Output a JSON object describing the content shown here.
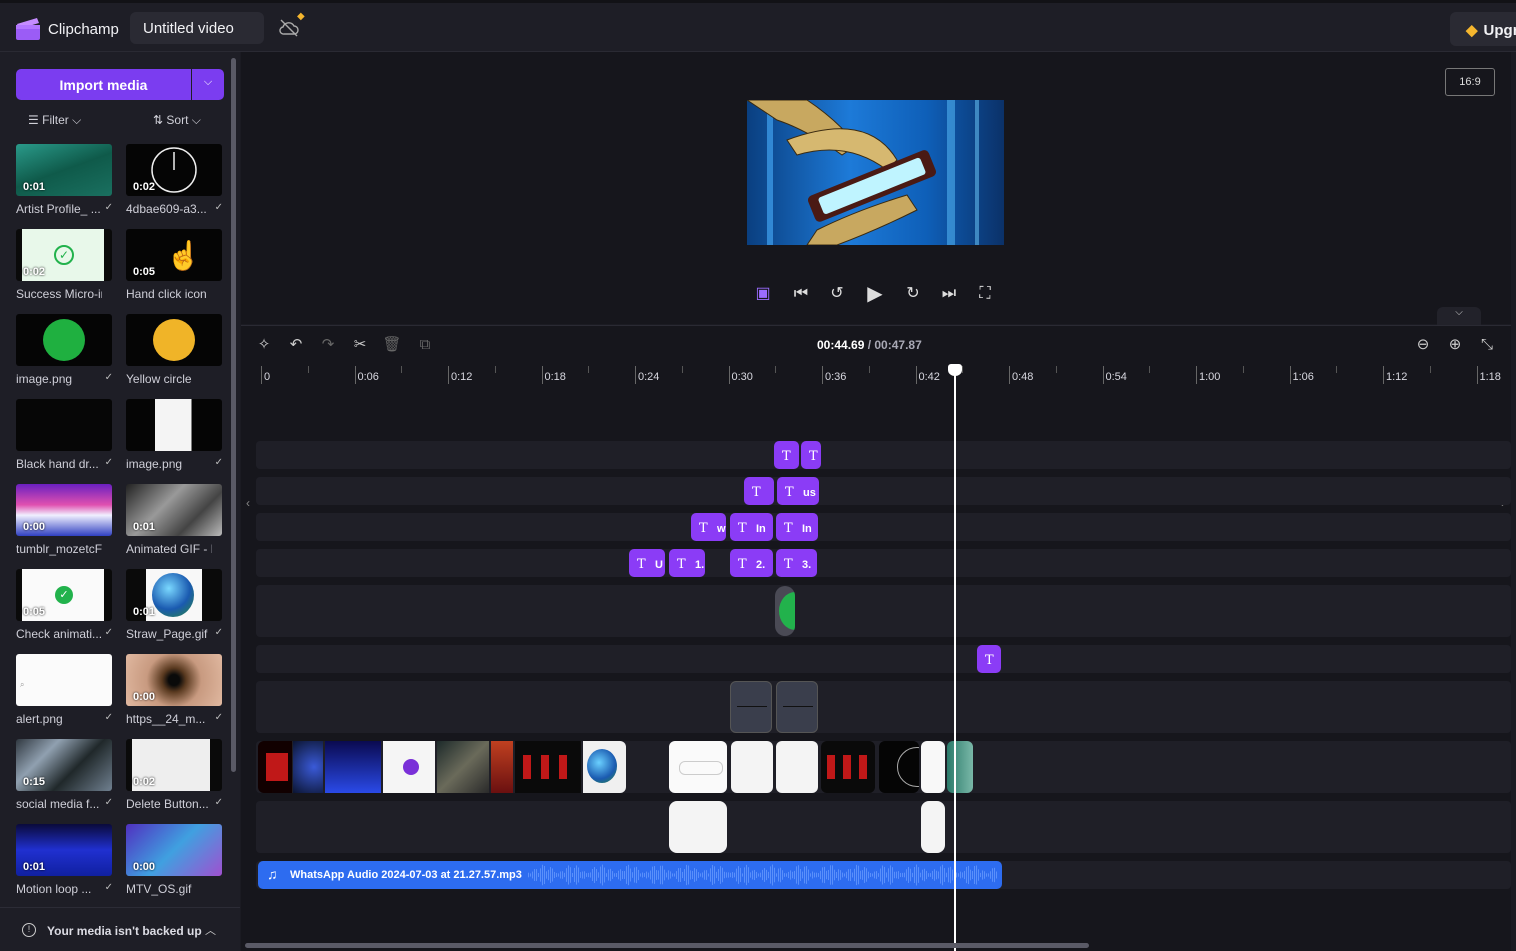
{
  "topbar": {
    "brand": "Clipchamp",
    "project_title": "Untitled video",
    "upgrade_label": "Upgrade"
  },
  "media_panel": {
    "import_label": "Import media",
    "filter_label": "Filter",
    "sort_label": "Sort",
    "items": [
      {
        "label": "Artist Profile_ ...",
        "duration": "0:01",
        "checked": true
      },
      {
        "label": "4dbae609-a3...",
        "duration": "0:02",
        "checked": true
      },
      {
        "label": "Success Micro-in...",
        "duration": "0:02",
        "checked": false
      },
      {
        "label": "Hand click icon",
        "duration": "0:05",
        "checked": false
      },
      {
        "label": "image.png",
        "duration": "",
        "checked": true
      },
      {
        "label": "Yellow circle",
        "duration": "",
        "checked": false
      },
      {
        "label": "Black hand dr...",
        "duration": "",
        "checked": true
      },
      {
        "label": "image.png",
        "duration": "",
        "checked": true
      },
      {
        "label": "tumblr_mozetcFt...",
        "duration": "0:00",
        "checked": false
      },
      {
        "label": "Animated GIF - F...",
        "duration": "0:01",
        "checked": false
      },
      {
        "label": "Check animati...",
        "duration": "0:05",
        "checked": true
      },
      {
        "label": "Straw_Page.gif",
        "duration": "0:01",
        "checked": true
      },
      {
        "label": "alert.png",
        "duration": "",
        "checked": true
      },
      {
        "label": "https__24_m...",
        "duration": "0:00",
        "checked": true
      },
      {
        "label": "social media f...",
        "duration": "0:15",
        "checked": true
      },
      {
        "label": "Delete Button...",
        "duration": "0:02",
        "checked": true
      },
      {
        "label": "Motion loop ...",
        "duration": "0:01",
        "checked": true
      },
      {
        "label": "MTV_OS.gif",
        "duration": "0:00",
        "checked": false
      }
    ],
    "backup_message": "Your media isn't backed up"
  },
  "preview": {
    "aspect_ratio": "16:9"
  },
  "timeline": {
    "current_time": "00:44.69",
    "total_time": "/ 00:47.87",
    "ruler_labels": [
      "0",
      "0:06",
      "0:12",
      "0:18",
      "0:24",
      "0:30",
      "0:36",
      "0:42",
      "0:48",
      "0:54",
      "1:00",
      "1:06",
      "1:12",
      "1:18"
    ],
    "text_clips": {
      "t_row2_b": "us",
      "t_row3_a": "w",
      "t_row3_b": "In",
      "t_row3_c": "In",
      "t_row4_a": "U",
      "t_row4_b": "1.",
      "t_row4_c": "2.",
      "t_row4_d": "3."
    },
    "audio_label": "WhatsApp Audio 2024-07-03 at 21.27.57.mp3"
  },
  "colors": {
    "accent": "#7b3df0",
    "text_clip": "#8b3cf6",
    "audio_clip": "#2d6cf0",
    "background": "#16161c"
  }
}
